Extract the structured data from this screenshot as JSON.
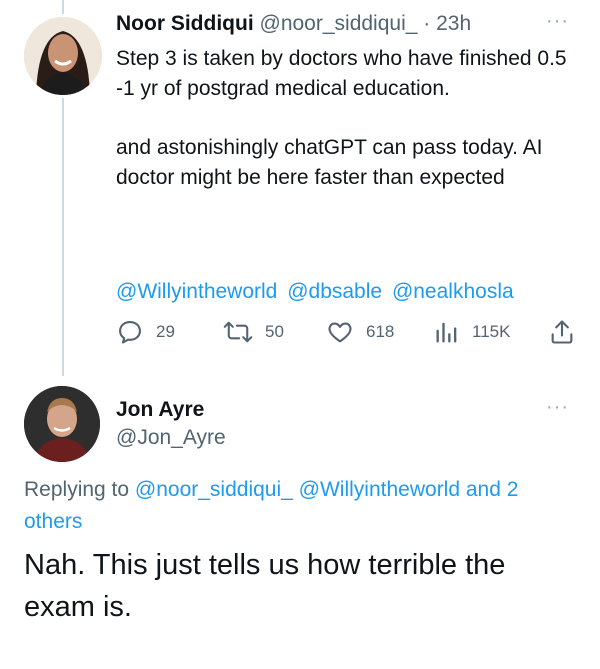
{
  "tweet1": {
    "author_name": "Noor Siddiqui",
    "handle": "@noor_siddiqui_",
    "separator": "·",
    "time": "23h",
    "more": "···",
    "para1": "Step 3 is taken by doctors who have finished 0.5 -1 yr of postgrad medical education.",
    "para2": "and astonishingly chatGPT can pass today. AI doctor might be here faster than expected",
    "mentions": [
      "@Willyintheworld",
      "@dbsable",
      "@nealkhosla"
    ],
    "actions": {
      "replies": "29",
      "retweets": "50",
      "likes": "618",
      "views": "115K"
    }
  },
  "tweet2": {
    "author_name": "Jon Ayre",
    "handle": "@Jon_Ayre",
    "more": "···",
    "replying_prefix": "Replying to",
    "replying_to": [
      "@noor_siddiqui_",
      "@Willyintheworld"
    ],
    "replying_suffix": "and 2 others",
    "body": "Nah. This just tells us how terrible the exam is."
  },
  "colors": {
    "link": "#1d9bf0",
    "secondary_text": "#536471",
    "primary_text": "#0f1419",
    "thread_line": "#cfd9de"
  },
  "icons": [
    "reply-icon",
    "retweet-icon",
    "like-icon",
    "views-icon",
    "share-icon",
    "more-icon"
  ]
}
